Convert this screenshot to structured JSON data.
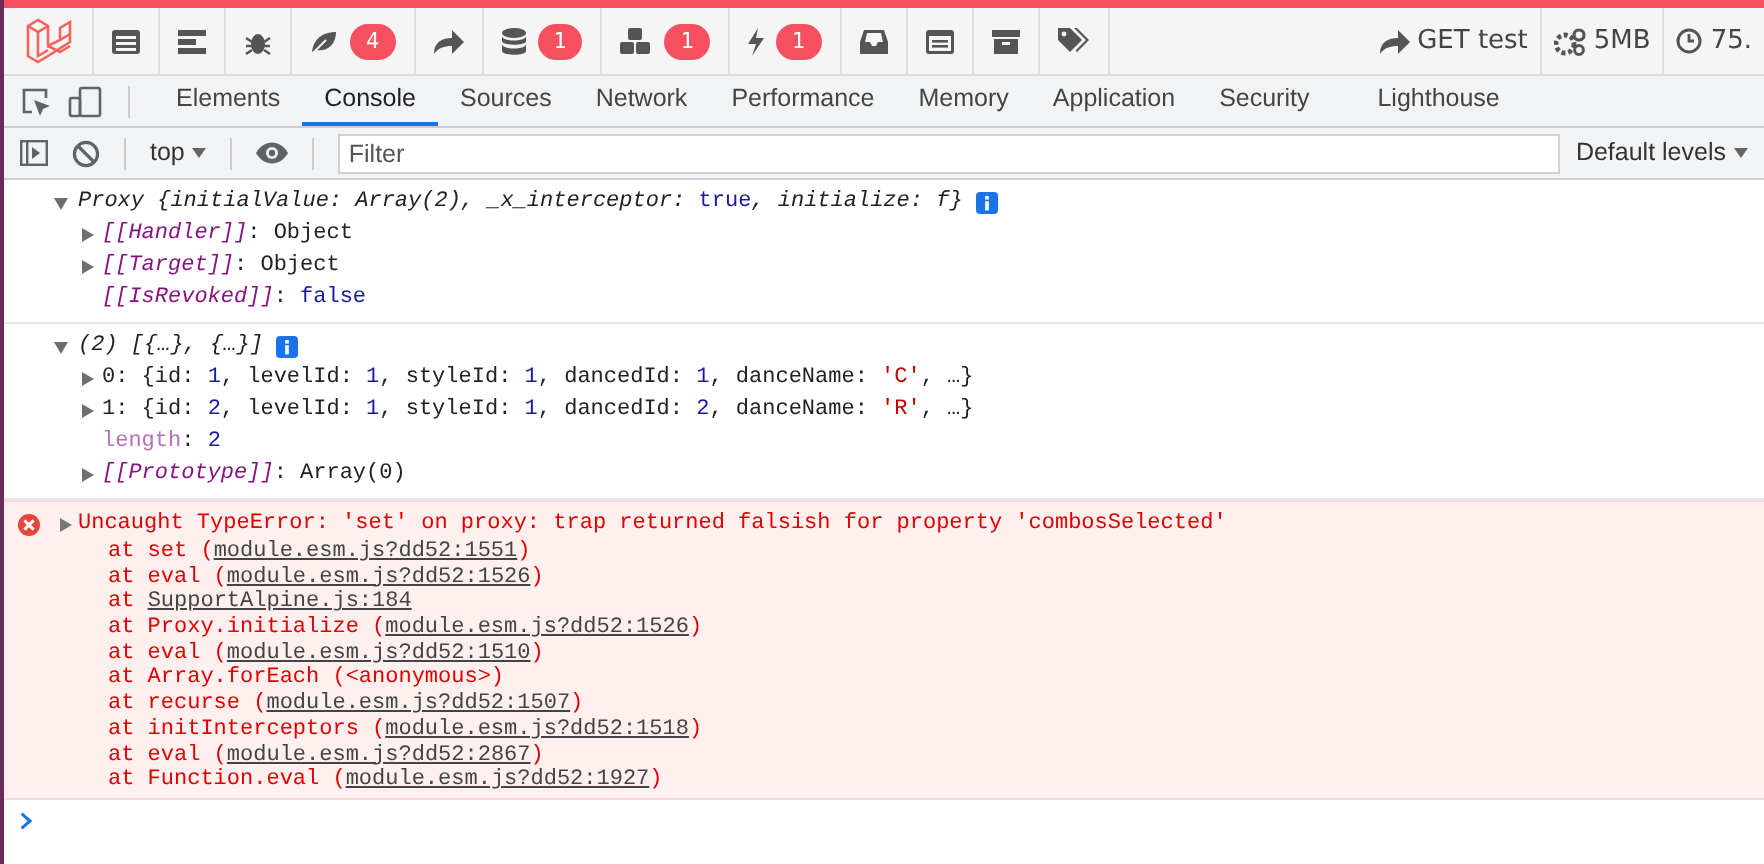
{
  "debugbar": {
    "items": [
      {
        "kind": "logo"
      },
      {
        "kind": "messages"
      },
      {
        "kind": "timeline"
      },
      {
        "kind": "exceptions"
      },
      {
        "kind": "views",
        "badge": "4"
      },
      {
        "kind": "route"
      },
      {
        "kind": "queries",
        "badge": "1"
      },
      {
        "kind": "models",
        "badge": "1"
      },
      {
        "kind": "events",
        "badge": "1"
      },
      {
        "kind": "session"
      },
      {
        "kind": "request"
      },
      {
        "kind": "cache"
      },
      {
        "kind": "tags"
      }
    ],
    "right_items": [
      {
        "kind": "route",
        "text": "GET test"
      },
      {
        "kind": "memory",
        "text": "5MB"
      },
      {
        "kind": "time",
        "text": "75."
      }
    ]
  },
  "toolbar": {
    "tools": [
      {
        "kind": "inspect"
      },
      {
        "kind": "device"
      }
    ],
    "tabs": [
      {
        "label": "Elements",
        "selected": false
      },
      {
        "label": "Console",
        "selected": true
      },
      {
        "label": "Sources",
        "selected": false
      },
      {
        "label": "Network",
        "selected": false
      },
      {
        "label": "Performance",
        "selected": false
      },
      {
        "label": "Memory",
        "selected": false
      },
      {
        "label": "Application",
        "selected": false
      },
      {
        "label": "Security",
        "selected": false
      },
      {
        "label": "Lighthouse",
        "selected": false
      }
    ]
  },
  "console_bar": {
    "context": "top",
    "filter": {
      "placeholder": "Filter"
    },
    "levels": "Default levels"
  },
  "messages": [
    {
      "kind": "object",
      "expanded": true,
      "info": true,
      "segments": [
        {
          "text": "Proxy {initialValue: Array(2), _x_interceptor: ",
          "kind": "preview"
        },
        {
          "text": "true",
          "kind": "keyword"
        },
        {
          "text": ", initialize: f}",
          "kind": "preview"
        }
      ],
      "children": [
        {
          "expanded": false,
          "segments": [
            {
              "text": "[[Handler]]",
              "kind": "internal"
            },
            {
              "text": ": Object",
              "kind": "plain"
            }
          ]
        },
        {
          "expanded": false,
          "segments": [
            {
              "text": "[[Target]]",
              "kind": "internal"
            },
            {
              "text": ": Object",
              "kind": "plain"
            }
          ]
        },
        {
          "segments": [
            {
              "text": "[[IsRevoked]]",
              "kind": "internal"
            },
            {
              "text": ": ",
              "kind": "plain"
            },
            {
              "text": "false",
              "kind": "keyword"
            }
          ]
        }
      ]
    },
    {
      "kind": "object",
      "expanded": true,
      "info": true,
      "segments": [
        {
          "text": "(2) [{…}, {…}]",
          "kind": "preview"
        }
      ],
      "children": [
        {
          "expanded": false,
          "segments": [
            {
              "text": "0: {id: ",
              "kind": "plain"
            },
            {
              "text": "1",
              "kind": "number"
            },
            {
              "text": ", levelId: ",
              "kind": "plain"
            },
            {
              "text": "1",
              "kind": "number"
            },
            {
              "text": ", styleId: ",
              "kind": "plain"
            },
            {
              "text": "1",
              "kind": "number"
            },
            {
              "text": ", dancedId: ",
              "kind": "plain"
            },
            {
              "text": "1",
              "kind": "number"
            },
            {
              "text": ", danceName: ",
              "kind": "plain"
            },
            {
              "text": "'C'",
              "kind": "string"
            },
            {
              "text": ", …}",
              "kind": "plain"
            }
          ]
        },
        {
          "expanded": false,
          "segments": [
            {
              "text": "1: {id: ",
              "kind": "plain"
            },
            {
              "text": "2",
              "kind": "number"
            },
            {
              "text": ", levelId: ",
              "kind": "plain"
            },
            {
              "text": "1",
              "kind": "number"
            },
            {
              "text": ", styleId: ",
              "kind": "plain"
            },
            {
              "text": "1",
              "kind": "number"
            },
            {
              "text": ", dancedId: ",
              "kind": "plain"
            },
            {
              "text": "2",
              "kind": "number"
            },
            {
              "text": ", danceName: ",
              "kind": "plain"
            },
            {
              "text": "'R'",
              "kind": "string"
            },
            {
              "text": ", …}",
              "kind": "plain"
            }
          ]
        },
        {
          "segments": [
            {
              "text": "length",
              "kind": "faint"
            },
            {
              "text": ": ",
              "kind": "plain"
            },
            {
              "text": "2",
              "kind": "number"
            }
          ]
        },
        {
          "expanded": false,
          "segments": [
            {
              "text": "[[Prototype]]",
              "kind": "internal"
            },
            {
              "text": ": Array(0)",
              "kind": "plain"
            }
          ]
        }
      ]
    },
    {
      "kind": "error",
      "expanded": false,
      "text": "Uncaught TypeError: 'set' on proxy: trap returned falsish for property 'combosSelected'",
      "frames": [
        {
          "prefix": "at set (",
          "link": "module.esm.js?dd52:1551",
          "suffix": ")"
        },
        {
          "prefix": "at eval (",
          "link": "module.esm.js?dd52:1526",
          "suffix": ")"
        },
        {
          "prefix": "at ",
          "link": "SupportAlpine.js:184"
        },
        {
          "prefix": "at Proxy.initialize (",
          "link": "module.esm.js?dd52:1526",
          "suffix": ")"
        },
        {
          "prefix": "at eval (",
          "link": "module.esm.js?dd52:1510",
          "suffix": ")"
        },
        {
          "prefix": "at Array.forEach (<anonymous>)"
        },
        {
          "prefix": "at recurse (",
          "link": "module.esm.js?dd52:1507",
          "suffix": ")"
        },
        {
          "prefix": "at initInterceptors (",
          "link": "module.esm.js?dd52:1518",
          "suffix": ")"
        },
        {
          "prefix": "at eval (",
          "link": "module.esm.js?dd52:2867",
          "suffix": ")"
        },
        {
          "prefix": "at Function.eval (",
          "link": "module.esm.js?dd52:1927",
          "suffix": ")"
        }
      ]
    }
  ]
}
